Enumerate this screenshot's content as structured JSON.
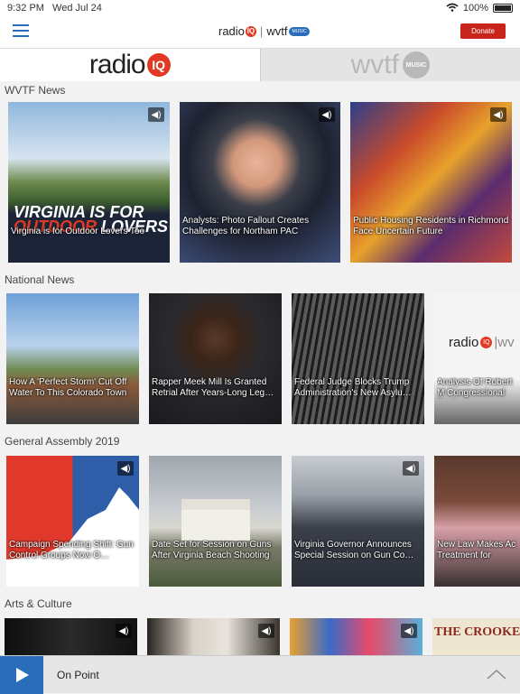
{
  "status": {
    "time": "9:32 PM",
    "date": "Wed Jul 24",
    "battery": "100%"
  },
  "header": {
    "logo_left": "radio",
    "logo_iq": "IQ",
    "logo_right": "wvtf",
    "logo_music": "MUSIC",
    "donate_label": "Donate"
  },
  "stations": {
    "radioiq": "radio",
    "radioiq_badge": "IQ",
    "wvtf": "wvtf",
    "wvtf_badge": "MUSIC"
  },
  "sections": [
    {
      "title": "WVTF News",
      "cards": [
        {
          "caption": "Virginia is for Outdoor Lovers Too",
          "audio": true
        },
        {
          "caption": "Analysts: Photo Fallout Creates Challenges for Northam PAC",
          "audio": true
        },
        {
          "caption": "Public Housing Residents in Richmond Face Uncertain Future",
          "audio": true
        }
      ]
    },
    {
      "title": "National News",
      "cards": [
        {
          "caption": "How A 'Perfect Storm' Cut Off Water To This Colorado Town",
          "audio": false
        },
        {
          "caption": "Rapper Meek Mill Is Granted Retrial After Years-Long Leg…",
          "audio": false
        },
        {
          "caption": "Federal Judge Blocks Trump Administration's New Asylu…",
          "audio": false
        },
        {
          "caption": "Analysis Of Robert M Congressional Testi",
          "audio": false
        }
      ]
    },
    {
      "title": "General Assembly 2019",
      "cards": [
        {
          "caption": "Campaign Spending Shift: Gun Control Groups Now O…",
          "audio": true
        },
        {
          "caption": "Date Set for Session on Guns After Virginia Beach Shooting",
          "audio": false
        },
        {
          "caption": "Virginia Governor Announces Special Session on Gun Co…",
          "audio": true
        },
        {
          "caption": "New Law Makes Ac Treatment for Autism",
          "audio": false
        }
      ]
    },
    {
      "title": "Arts & Culture",
      "cards": [
        {
          "caption": "",
          "audio": true
        },
        {
          "caption": "",
          "audio": true
        },
        {
          "caption": "",
          "audio": true
        },
        {
          "caption": "",
          "audio": false
        }
      ]
    }
  ],
  "player": {
    "now_playing": "On Point"
  },
  "colors": {
    "accent": "#2a6ebb",
    "donate": "#c8241b",
    "iq_red": "#e03a24"
  }
}
